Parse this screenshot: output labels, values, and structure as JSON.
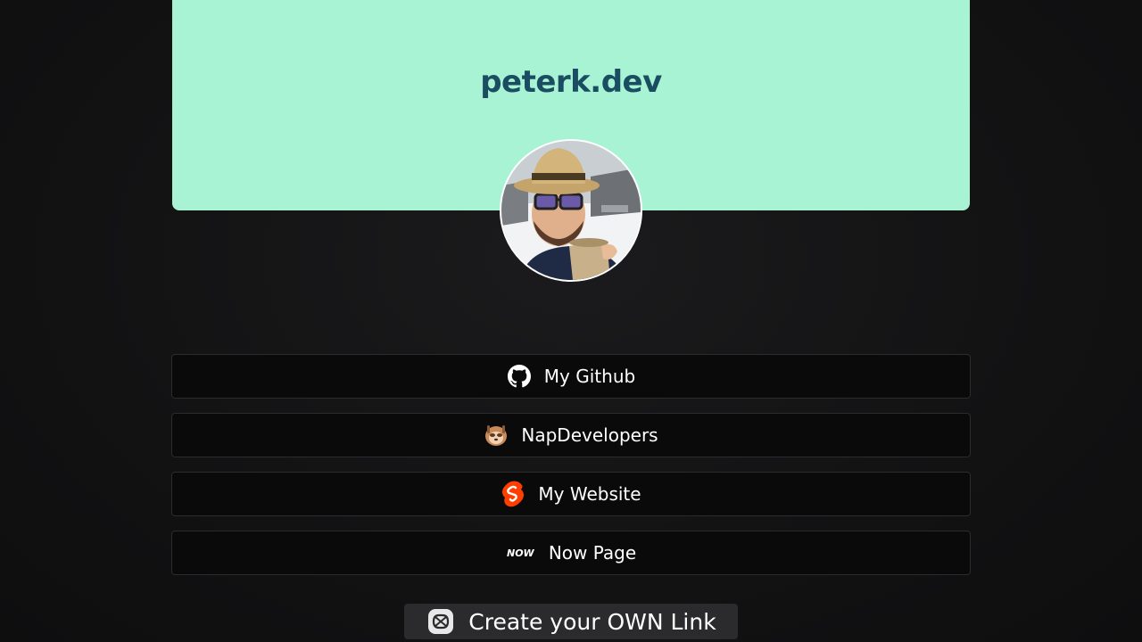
{
  "header": {
    "title": "peterk.dev",
    "background_color": "#a8f3d3",
    "title_color": "#1a4d61"
  },
  "avatar": {
    "alt": "profile photo"
  },
  "links": [
    {
      "label": "My Github",
      "icon": "github-icon"
    },
    {
      "label": "NapDevelopers",
      "icon": "sloth-icon"
    },
    {
      "label": "My Website",
      "icon": "svelte-icon"
    },
    {
      "label": "Now Page",
      "icon": "now-icon"
    }
  ],
  "cta": {
    "label": "Create your OWN Link",
    "icon": "link-logo-icon"
  },
  "colors": {
    "background": "#121213",
    "button_bg": "#0a0a0b",
    "button_border": "#2c2c2f",
    "svelte": "#ff3e00"
  }
}
